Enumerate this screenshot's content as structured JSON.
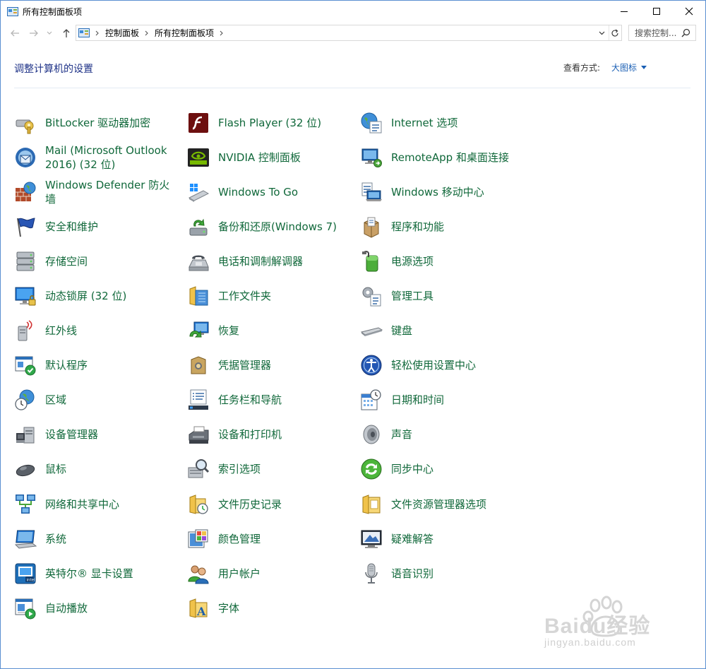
{
  "window": {
    "title": "所有控制面板项"
  },
  "address": {
    "breadcrumbs": [
      "控制面板",
      "所有控制面板项"
    ],
    "search_placeholder": "搜索控制..."
  },
  "header": {
    "title": "调整计算机的设置",
    "view_by_label": "查看方式:",
    "view_by_value": "大图标"
  },
  "items": [
    {
      "label": "BitLocker 驱动器加密",
      "icon": "bitlocker-icon"
    },
    {
      "label": "Flash Player (32 位)",
      "icon": "flash-player-icon"
    },
    {
      "label": "Internet 选项",
      "icon": "internet-options-icon"
    },
    {
      "label": "Mail (Microsoft Outlook 2016) (32 位)",
      "icon": "mail-icon"
    },
    {
      "label": "NVIDIA 控制面板",
      "icon": "nvidia-icon"
    },
    {
      "label": "RemoteApp 和桌面连接",
      "icon": "remoteapp-icon"
    },
    {
      "label": "Windows Defender 防火墙",
      "icon": "firewall-icon"
    },
    {
      "label": "Windows To Go",
      "icon": "windows-to-go-icon"
    },
    {
      "label": "Windows 移动中心",
      "icon": "mobility-center-icon"
    },
    {
      "label": "安全和维护",
      "icon": "security-flag-icon"
    },
    {
      "label": "备份和还原(Windows 7)",
      "icon": "backup-restore-icon"
    },
    {
      "label": "程序和功能",
      "icon": "programs-features-icon"
    },
    {
      "label": "存储空间",
      "icon": "storage-spaces-icon"
    },
    {
      "label": "电话和调制解调器",
      "icon": "phone-modem-icon"
    },
    {
      "label": "电源选项",
      "icon": "power-options-icon"
    },
    {
      "label": "动态锁屏 (32 位)",
      "icon": "dynamic-lock-icon"
    },
    {
      "label": "工作文件夹",
      "icon": "work-folders-icon"
    },
    {
      "label": "管理工具",
      "icon": "admin-tools-icon"
    },
    {
      "label": "红外线",
      "icon": "infrared-icon"
    },
    {
      "label": "恢复",
      "icon": "recovery-icon"
    },
    {
      "label": "键盘",
      "icon": "keyboard-icon"
    },
    {
      "label": "默认程序",
      "icon": "default-programs-icon"
    },
    {
      "label": "凭据管理器",
      "icon": "credential-manager-icon"
    },
    {
      "label": "轻松使用设置中心",
      "icon": "ease-of-access-icon"
    },
    {
      "label": "区域",
      "icon": "region-icon"
    },
    {
      "label": "任务栏和导航",
      "icon": "taskbar-icon"
    },
    {
      "label": "日期和时间",
      "icon": "date-time-icon"
    },
    {
      "label": "设备管理器",
      "icon": "device-manager-icon"
    },
    {
      "label": "设备和打印机",
      "icon": "devices-printers-icon"
    },
    {
      "label": "声音",
      "icon": "sound-icon"
    },
    {
      "label": "鼠标",
      "icon": "mouse-icon"
    },
    {
      "label": "索引选项",
      "icon": "indexing-icon"
    },
    {
      "label": "同步中心",
      "icon": "sync-center-icon"
    },
    {
      "label": "网络和共享中心",
      "icon": "network-icon"
    },
    {
      "label": "文件历史记录",
      "icon": "file-history-icon"
    },
    {
      "label": "文件资源管理器选项",
      "icon": "explorer-options-icon"
    },
    {
      "label": "系统",
      "icon": "system-icon"
    },
    {
      "label": "颜色管理",
      "icon": "color-management-icon"
    },
    {
      "label": "疑难解答",
      "icon": "troubleshooting-icon"
    },
    {
      "label": "英特尔® 显卡设置",
      "icon": "intel-graphics-icon"
    },
    {
      "label": "用户帐户",
      "icon": "user-accounts-icon"
    },
    {
      "label": "语音识别",
      "icon": "speech-recognition-icon"
    },
    {
      "label": "自动播放",
      "icon": "autoplay-icon"
    },
    {
      "label": "字体",
      "icon": "fonts-icon"
    }
  ],
  "watermark": {
    "brand": "Baidu经验",
    "url": "jingyan.baidu.com"
  },
  "colors": {
    "link_green": "#10683a",
    "title_blue": "#1e3287",
    "accent_blue": "#1a5fb4"
  }
}
